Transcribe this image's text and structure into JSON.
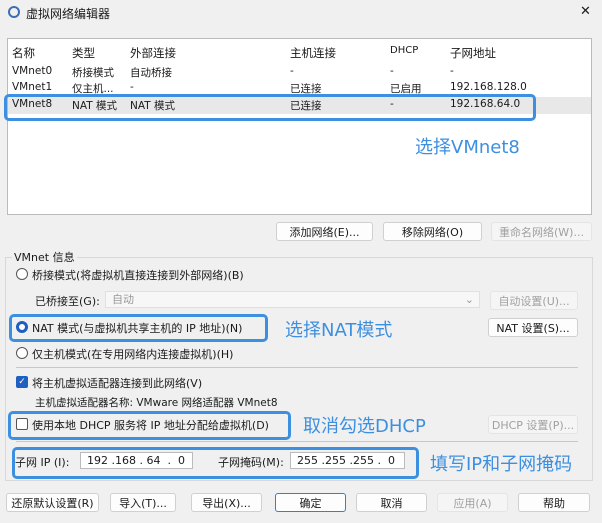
{
  "window": {
    "title": "虚拟网络编辑器",
    "close": "✕"
  },
  "table": {
    "headers": [
      "名称",
      "类型",
      "外部连接",
      "主机连接",
      "DHCP",
      "子网地址"
    ],
    "rows": [
      [
        "VMnet0",
        "桥接模式",
        "自动桥接",
        "-",
        "-",
        "-"
      ],
      [
        "VMnet1",
        "仅主机...",
        "-",
        "已连接",
        "已启用",
        "192.168.128.0"
      ],
      [
        "VMnet8",
        "NAT 模式",
        "NAT 模式",
        "已连接",
        "-",
        "192.168.64.0"
      ]
    ]
  },
  "table_buttons": {
    "add": "添加网络(E)...",
    "remove": "移除网络(O)",
    "rename": "重命名网络(W)..."
  },
  "info": {
    "legend": "VMnet 信息",
    "bridge": "桥接模式(将虚拟机直接连接到外部网络)(B)",
    "bridged_to_label": "已桥接至(G):",
    "bridged_to_value": "自动",
    "auto_settings": "自动设置(U)...",
    "nat": "NAT 模式(与虚拟机共享主机的 IP 地址)(N)",
    "nat_settings": "NAT 设置(S)...",
    "host_only": "仅主机模式(在专用网络内连接虚拟机)(H)",
    "connect_adapter": "将主机虚拟适配器连接到此网络(V)",
    "adapter_name": "主机虚拟适配器名称: VMware 网络适配器 VMnet8",
    "dhcp": "使用本地 DHCP 服务将 IP 地址分配给虚拟机(D)",
    "dhcp_settings": "DHCP 设置(P)...",
    "subnet_ip_label": "子网 IP (I):",
    "subnet_ip": "192 .168 . 64  .  0",
    "subnet_mask_label": "子网掩码(M):",
    "subnet_mask": "255 .255 .255 .  0"
  },
  "annotations": {
    "a1": "选择VMnet8",
    "a2": "选择NAT模式",
    "a3": "取消勾选DHCP",
    "a4": "填写IP和子网掩码"
  },
  "footer": {
    "restore": "还原默认设置(R)",
    "import": "导入(T)...",
    "export": "导出(X)...",
    "ok": "确定",
    "cancel": "取消",
    "apply": "应用(A)",
    "help": "帮助"
  }
}
